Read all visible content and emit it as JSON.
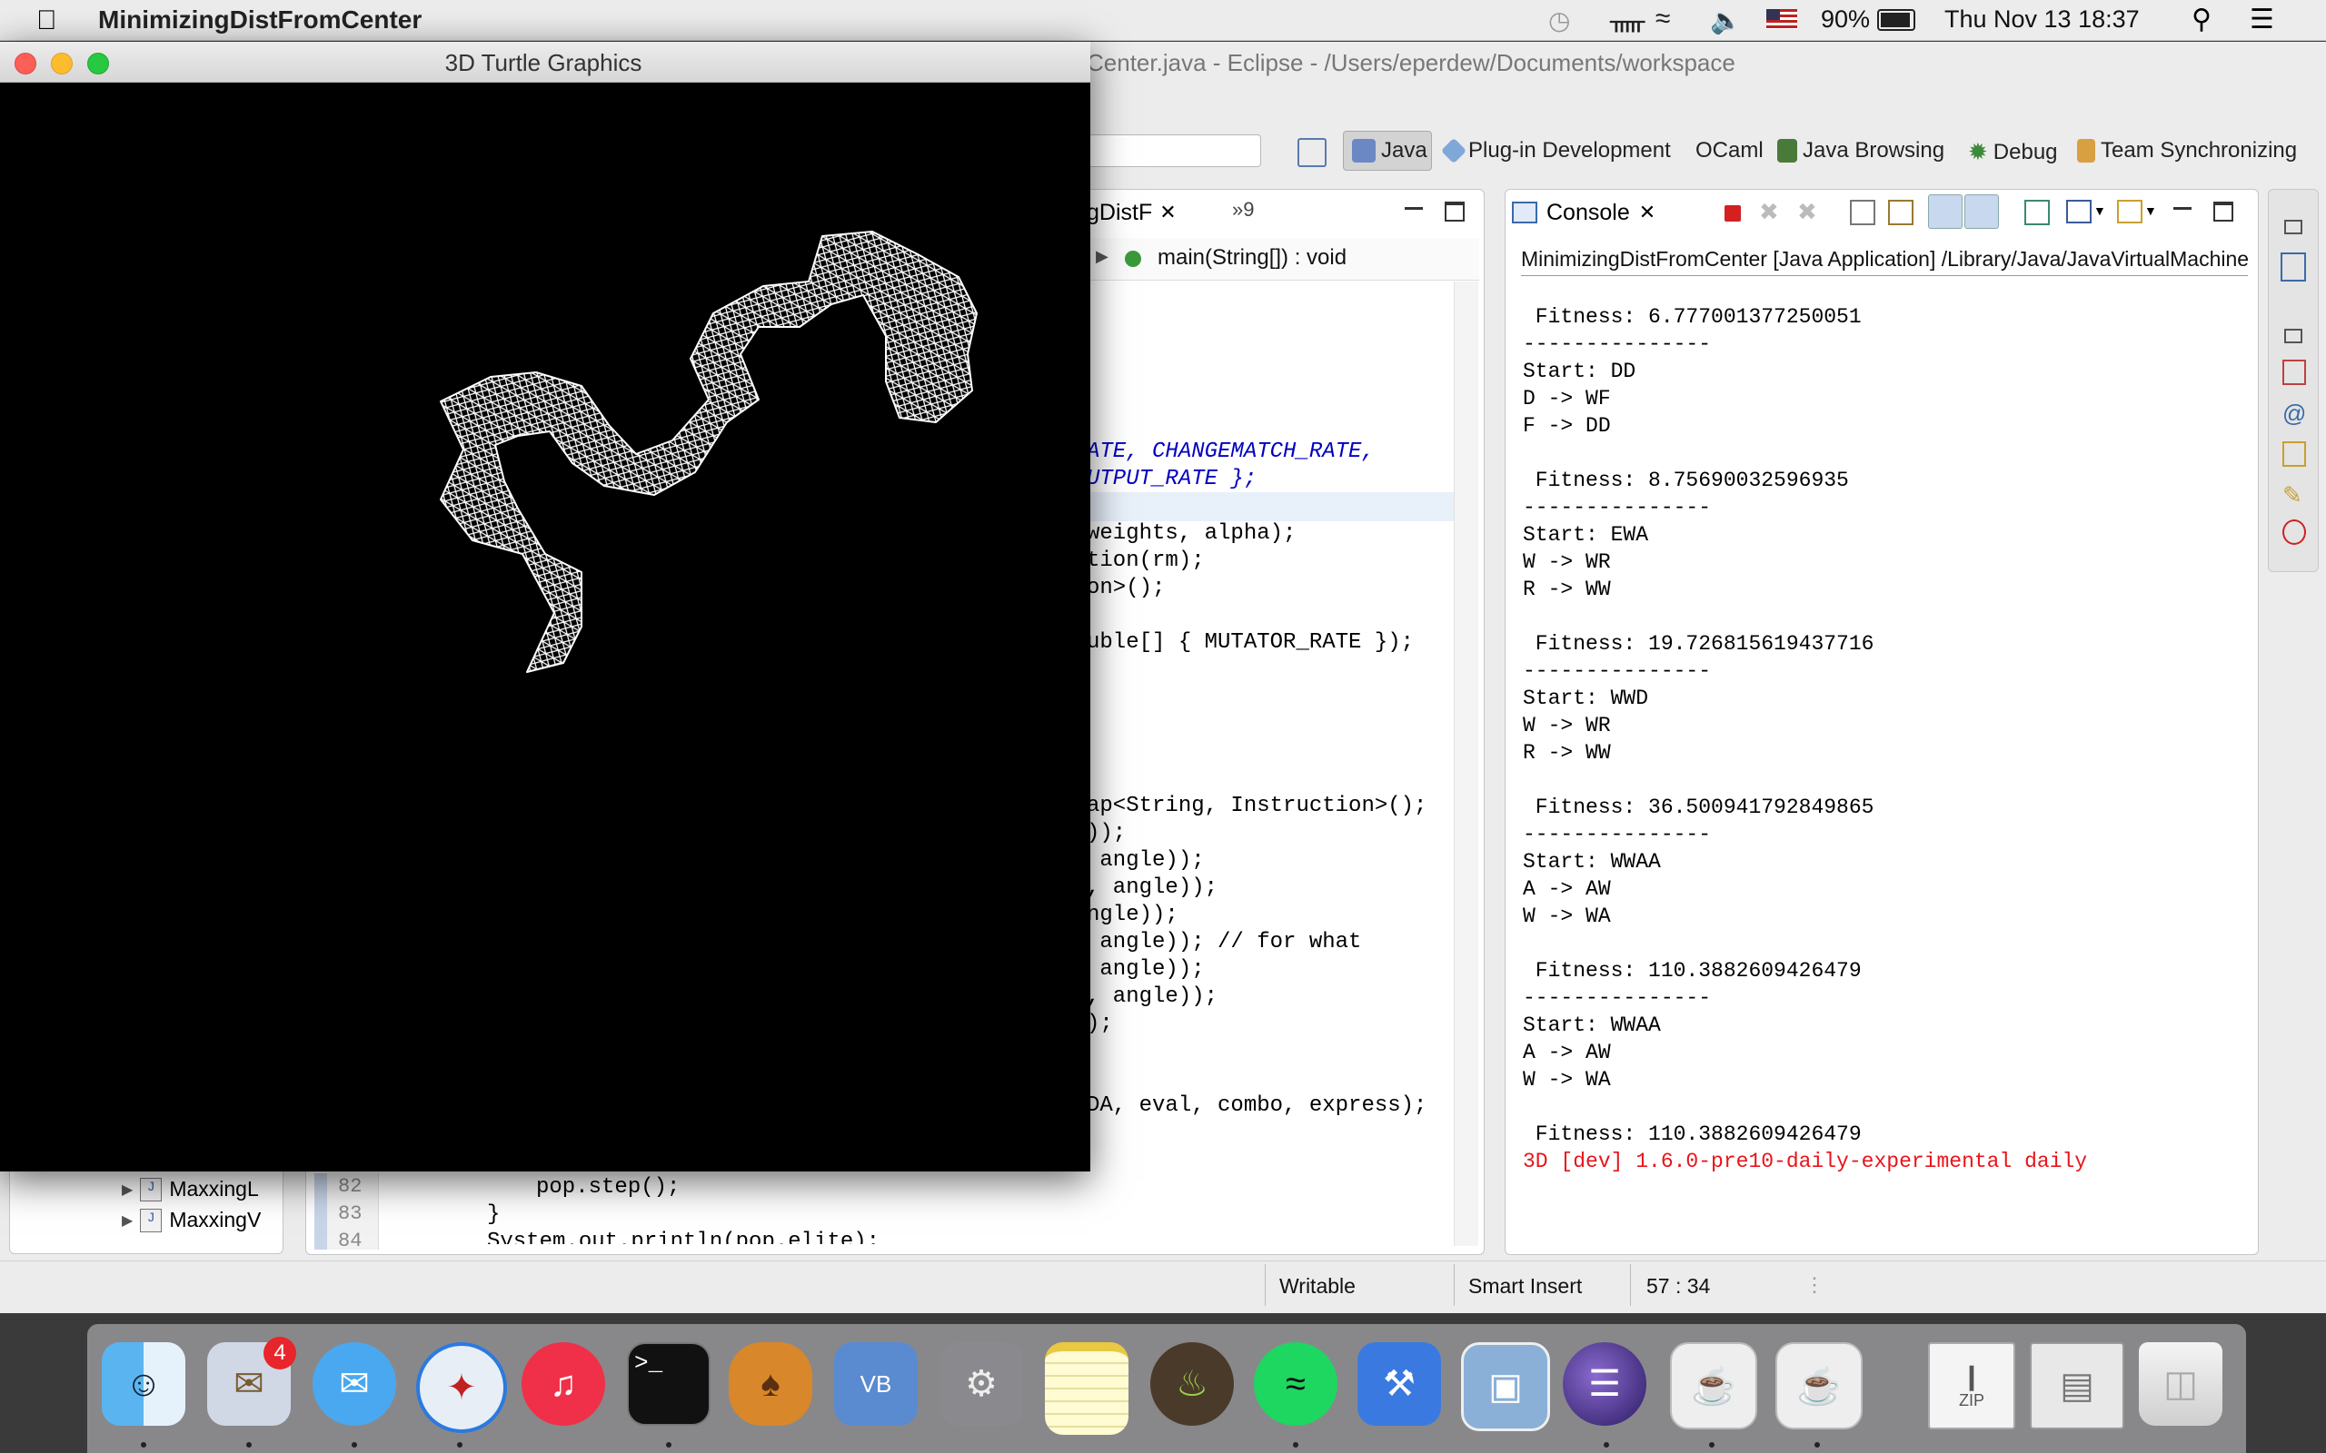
{
  "menubar": {
    "app_name": "MinimizingDistFromCenter",
    "battery": "90%",
    "clock": "Thu Nov 13  18:37"
  },
  "eclipse": {
    "title": "Center.java - Eclipse - /Users/eperdew/Documents/workspace",
    "perspectives": [
      "Java",
      "Plug-in Development",
      "OCaml",
      "Java Browsing",
      "Debug",
      "Team Synchronizing"
    ],
    "editor_tab": "gDistF",
    "overflow_tab": "»9",
    "breadcrumb": "main(String[]) : void",
    "console_tab": "Console",
    "console_header": "MinimizingDistFromCenter [Java Application] /Library/Java/JavaVirtualMachine",
    "code_lines": [
      "ATE, CHANGEMATCH_RATE,",
      "UTPUT_RATE };",
      "weights, alpha);",
      "tion(rm);",
      "on>();",
      "uble[] { MUTATOR_RATE });",
      "ap<String, Instruction>();",
      "));",
      " angle));",
      ", angle));",
      "ngle));",
      " angle)); // for what",
      " angle));",
      ", angle));",
      ");",
      "DA, eval, combo, express);"
    ],
    "lower_code": {
      "line82_num": "82",
      "line82": "pop.step();",
      "line83_num": "83",
      "line83": "}",
      "line84_num": "84",
      "line84": "System.out.println(pop.elite);"
    },
    "tree_items": [
      "MaxxingL",
      "MaxxingV"
    ],
    "console_lines": [
      " Fitness: 6.777001377250051",
      "---------------",
      "Start: DD",
      "D -> WF",
      "F -> DD",
      "",
      " Fitness: 8.75690032596935",
      "---------------",
      "Start: EWA",
      "W -> WR",
      "R -> WW",
      "",
      " Fitness: 19.726815619437716",
      "---------------",
      "Start: WWD",
      "W -> WR",
      "R -> WW",
      "",
      " Fitness: 36.500941792849865",
      "---------------",
      "Start: WWAA",
      "A -> AW",
      "W -> WA",
      "",
      " Fitness: 110.3882609426479",
      "---------------",
      "Start: WWAA",
      "A -> AW",
      "W -> WA",
      "",
      " Fitness: 110.3882609426479"
    ],
    "console_error": "3D [dev] 1.6.0-pre10-daily-experimental daily",
    "status": {
      "writable": "Writable",
      "insert": "Smart Insert",
      "position": "57 : 34"
    }
  },
  "turtle_window": {
    "title": "3D Turtle Graphics"
  },
  "dock": {
    "mail_badge": "4",
    "zip_label": "ZIP"
  },
  "colors": {
    "error_red": "#e8141a",
    "keyword_blue": "#0000c0",
    "comment_green": "#3f7f5f"
  }
}
